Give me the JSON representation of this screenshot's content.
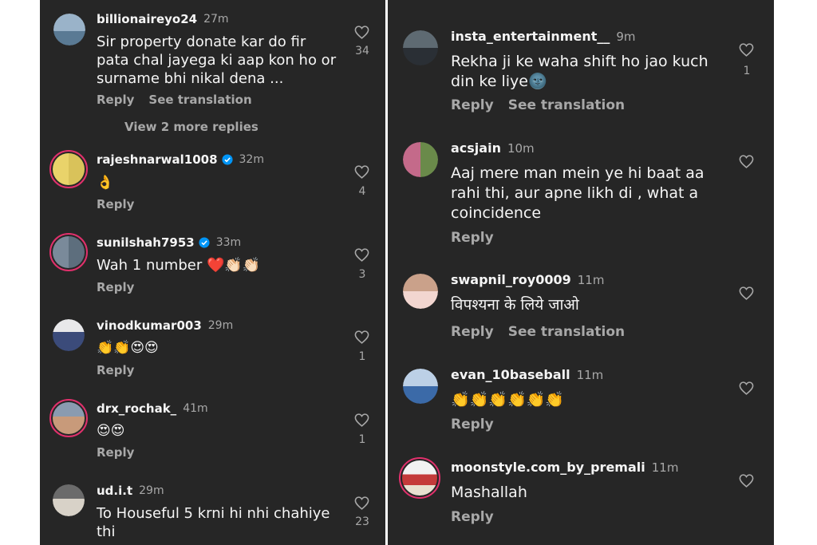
{
  "left_comments": [
    {
      "username": "billionaireyo24",
      "time": "27m",
      "verified": false,
      "text": "Sir property donate kar do fir\npata chal jayega ki aap kon ho or\nsurname bhi nikal dena ...",
      "reply": "Reply",
      "see_translation": "See translation",
      "likes": "34",
      "view_replies": "View 2 more replies"
    },
    {
      "username": "rajeshnarwal1008",
      "time": "32m",
      "verified": true,
      "text": "👌",
      "reply": "Reply",
      "likes": "4"
    },
    {
      "username": "sunilshah7953",
      "time": "33m",
      "verified": true,
      "text": "Wah 1 number ❤️👏🏻👏🏻",
      "reply": "Reply",
      "likes": "3"
    },
    {
      "username": "vinodkumar003",
      "time": "29m",
      "verified": false,
      "text": "👏👏😍😍",
      "reply": "Reply",
      "likes": "1"
    },
    {
      "username": "drx_rochak_",
      "time": "41m",
      "verified": false,
      "text": "😍😍",
      "reply": "Reply",
      "likes": "1"
    },
    {
      "username": "ud.i.t",
      "time": "29m",
      "verified": false,
      "text": "To Houseful 5 krni hi nhi chahiye\nthi",
      "likes": "23"
    }
  ],
  "right_comments": [
    {
      "username": "insta_entertainment__",
      "time": "9m",
      "text": "Rekha ji ke waha shift ho jao kuch\ndin ke liye🌚",
      "reply": "Reply",
      "see_translation": "See translation",
      "likes": "1"
    },
    {
      "username": "acsjain",
      "time": "10m",
      "text": "Aaj mere man mein ye hi baat aa\nrahi thi, aur apne likh di , what a\ncoincidence",
      "reply": "Reply",
      "likes": ""
    },
    {
      "username": "swapnil_roy0009",
      "time": "11m",
      "text": "विपश्यना के लिये जाओ",
      "reply": "Reply",
      "see_translation": "See translation",
      "likes": ""
    },
    {
      "username": "evan_10baseball",
      "time": "11m",
      "text": "👏👏👏👏👏👏",
      "reply": "Reply",
      "likes": ""
    },
    {
      "username": "moonstyle.com_by_premali",
      "time": "11m",
      "text": "Mashallah",
      "reply": "Reply",
      "likes": ""
    }
  ],
  "colors": {
    "background": "#262626",
    "text": "#f5f5f5",
    "muted": "#a8a8a8",
    "verified": "#0095f6",
    "story_ring": "#e1306c"
  },
  "icons": {
    "like": "heart-outline-icon",
    "verified": "verified-badge-icon"
  }
}
